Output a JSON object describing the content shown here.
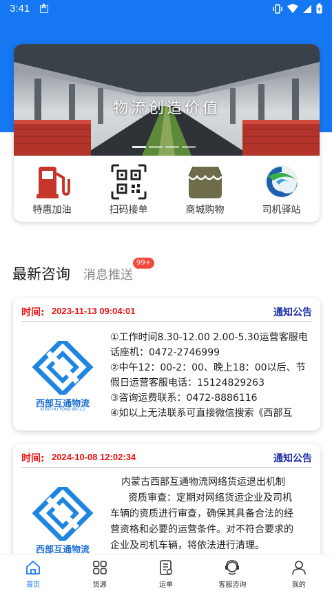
{
  "status_bar": {
    "time": "3:41"
  },
  "banner": {
    "slogan": "物流创造价值"
  },
  "quick_menu": [
    {
      "label": "特惠加油",
      "icon": "fuel-pump-icon"
    },
    {
      "label": "扫码接单",
      "icon": "qr-code-icon"
    },
    {
      "label": "商城购物",
      "icon": "shop-icon"
    },
    {
      "label": "司机驿站",
      "icon": "driver-station-icon"
    }
  ],
  "section": {
    "title": "最新咨询",
    "subtitle": "消息推送",
    "badge": "99+"
  },
  "logo_text": {
    "cn": "西部互通物流",
    "pinyin": "XI BU HU TONG WU LU"
  },
  "notices": [
    {
      "time_label": "时间:",
      "time": "2023-11-13 09:04:01",
      "type": "通知公告",
      "lines": [
        "①工作时间8.30-12.00 2.00-5.30运营客服电",
        "话座机：0472-2746999",
        "②中午12：00-2：00、晚上18：00以后、节",
        "假日运营客服电话：15124829263",
        "③咨询运费联系：0472-8886116",
        "④如以上无法联系可直接微信搜索《西部互"
      ]
    },
    {
      "time_label": "时间:",
      "time": "2024-10-08 12:02:34",
      "type": "通知公告",
      "lines": [
        "内蒙古西部互通物流网络货运退出机制",
        "资质审查：定期对网络货运企业及司机",
        "车辆的资质进行审查，确保其具备合法的经",
        "营资格和必要的运营条件。对不符合要求的",
        "企业及司机车辆，将依法进行清理。"
      ]
    }
  ],
  "tabs": [
    {
      "label": "首页",
      "icon": "home-icon",
      "active": true
    },
    {
      "label": "货源",
      "icon": "grid-icon",
      "active": false
    },
    {
      "label": "运单",
      "icon": "waybill-icon",
      "active": false
    },
    {
      "label": "客服咨询",
      "icon": "headset-icon",
      "active": false
    },
    {
      "label": "我的",
      "icon": "user-icon",
      "active": false
    }
  ],
  "colors": {
    "primary": "#1677f2",
    "alert_red": "#e11111",
    "notice_blue": "#1a2ea8",
    "badge_red": "#f2483c"
  }
}
